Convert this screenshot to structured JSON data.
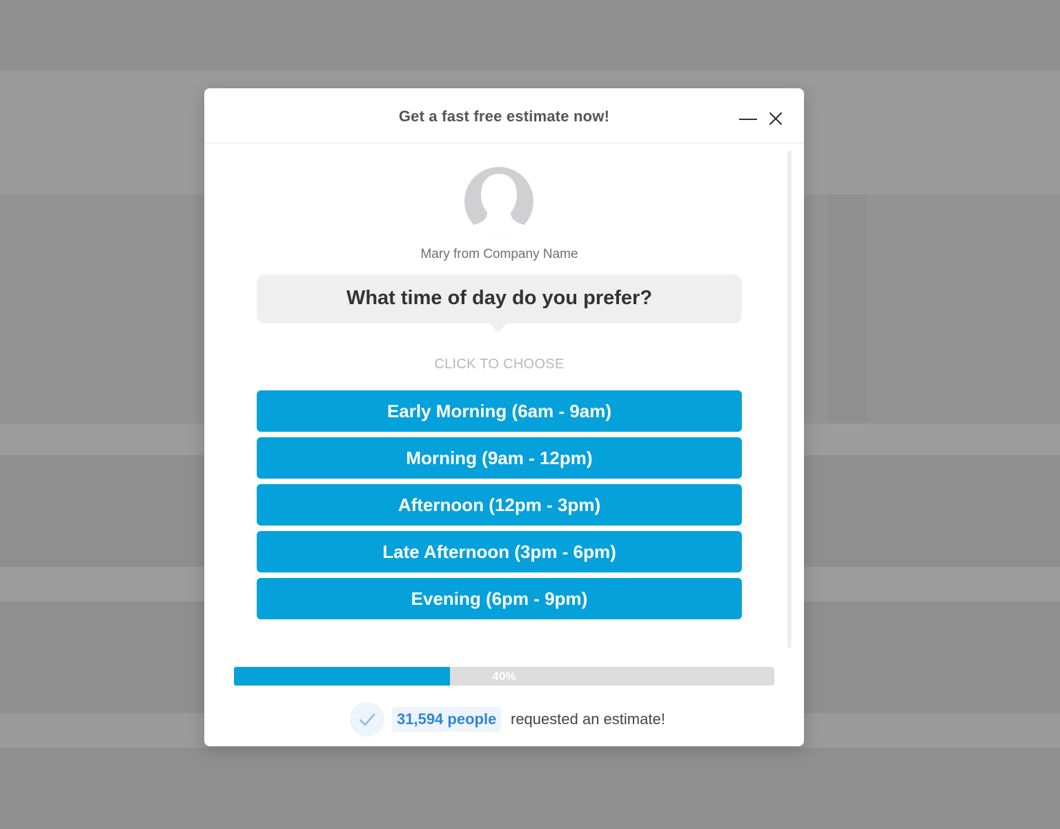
{
  "header": {
    "title": "Get a fast free estimate now!",
    "minimize_icon": "minimize-icon",
    "close_icon": "close-icon"
  },
  "agent": {
    "avatar_icon": "user-silhouette-icon",
    "name": "Mary from Company Name"
  },
  "question": "What time of day do you prefer?",
  "choose_label": "CLICK TO CHOOSE",
  "options": [
    {
      "label": "Early Morning (6am - 9am)"
    },
    {
      "label": "Morning (9am - 12pm)"
    },
    {
      "label": "Afternoon (12pm - 3pm)"
    },
    {
      "label": "Late Afternoon (3pm - 6pm)"
    },
    {
      "label": "Evening (6pm - 9pm)"
    }
  ],
  "progress": {
    "percent": 40,
    "label": "40%"
  },
  "social_proof": {
    "count_text": "31,594 people",
    "message": "requested an estimate!"
  },
  "colors": {
    "accent": "#05a1da",
    "link": "#2f86d8",
    "overlay": "#8f8f8f"
  }
}
